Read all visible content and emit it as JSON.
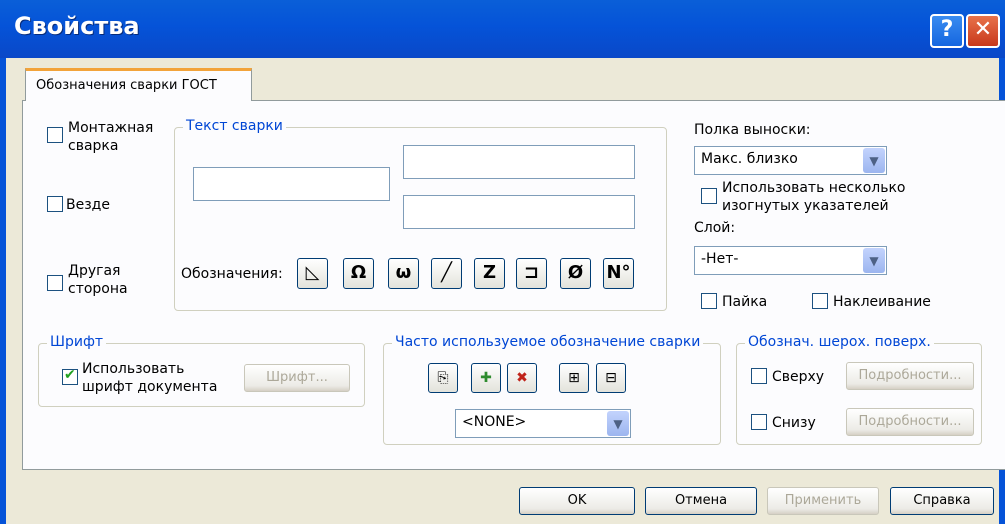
{
  "window": {
    "title": "Свойства",
    "help_glyph": "?",
    "close_glyph": "✕"
  },
  "tab": {
    "label": "Обозначения сварки ГОСТ"
  },
  "left_checks": {
    "mount_l1": "Монтажная",
    "mount_l2": "сварка",
    "everywhere": "Везде",
    "other_l1": "Другая",
    "other_l2": "сторона"
  },
  "weld_text": {
    "legend": "Текст сварки",
    "symbols_label": "Обозначения:",
    "symbols": [
      "◺",
      "Ω",
      "ω",
      "╱",
      "Z",
      "⊐",
      "Ø",
      "N°"
    ]
  },
  "shelf": {
    "label": "Полка выноски:",
    "value": "Макс. близко",
    "multi_l1": "Использовать несколько",
    "multi_l2": "изогнутых указателей"
  },
  "layer": {
    "label": "Слой:",
    "value": "-Нет-"
  },
  "solder": "Пайка",
  "glue": "Наклеивание",
  "font": {
    "legend": "Шрифт",
    "use_l1": "Использовать",
    "use_l2": "шрифт документа",
    "use_checked": true,
    "button": "Шрифт..."
  },
  "frequent": {
    "legend": "Часто используемое обозначение сварки",
    "value": "<NONE>"
  },
  "roughness": {
    "legend": "Обознач. шерох. поверх.",
    "top": "Сверху",
    "bottom": "Снизу",
    "details": "Подробности..."
  },
  "footer": {
    "ok": "OK",
    "cancel": "Отмена",
    "apply": "Применить",
    "help": "Справка"
  }
}
